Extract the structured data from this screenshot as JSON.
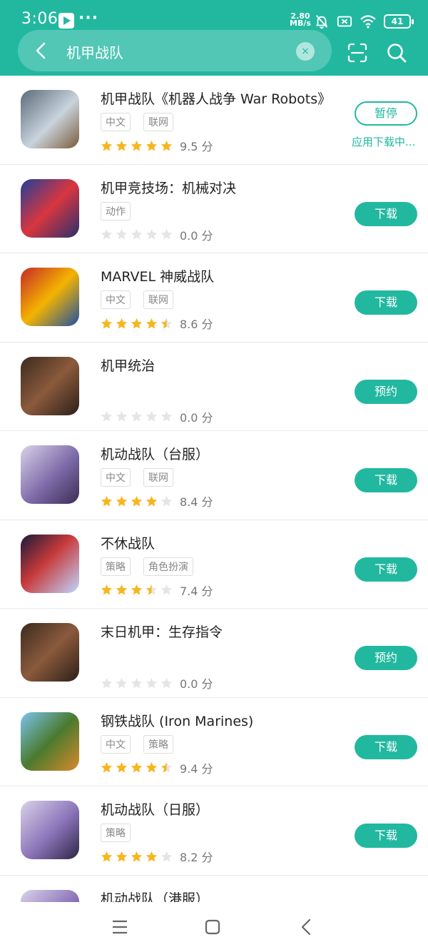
{
  "status_bar": {
    "time": "3:06",
    "more": "···",
    "speed_value": "2.80",
    "speed_unit": "MB/s",
    "battery": "41"
  },
  "search": {
    "query": "机甲战队",
    "clear_symbol": "×"
  },
  "colors": {
    "accent": "#22b8a0",
    "star_filled": "#f7b61f",
    "star_empty": "#e5e5e5"
  },
  "apps": [
    {
      "title": "机甲战队《机器人战争 War Robots》",
      "tags": [
        "中文",
        "联网"
      ],
      "stars": 5,
      "score": "9.5 分",
      "action": "暂停",
      "status": "应用下载中..."
    },
    {
      "title": "机甲竞技场：机械对决",
      "tags": [
        "动作"
      ],
      "stars": 0,
      "score": "0.0 分",
      "action": "下载"
    },
    {
      "title": "MARVEL 神威战队",
      "tags": [
        "中文",
        "联网"
      ],
      "stars": 4.5,
      "score": "8.6 分",
      "action": "下载"
    },
    {
      "title": "机甲统治",
      "tags": [],
      "stars": 0,
      "score": "0.0 分",
      "action": "预约"
    },
    {
      "title": "机动战队（台服）",
      "tags": [
        "中文",
        "联网"
      ],
      "stars": 4,
      "score": "8.4 分",
      "action": "下载"
    },
    {
      "title": "不休战队",
      "tags": [
        "策略",
        "角色扮演"
      ],
      "stars": 3.5,
      "score": "7.4 分",
      "action": "下载"
    },
    {
      "title": "末日机甲：生存指令",
      "tags": [],
      "stars": 0,
      "score": "0.0 分",
      "action": "预约"
    },
    {
      "title": "钢铁战队 (Iron Marines)",
      "tags": [
        "中文",
        "策略"
      ],
      "stars": 4.5,
      "score": "9.4 分",
      "action": "下载"
    },
    {
      "title": "机动战队（日服）",
      "tags": [
        "策略"
      ],
      "stars": 4,
      "score": "8.2 分",
      "action": "下载"
    },
    {
      "title": "机动战队（港服）",
      "tags": [],
      "stars": 0,
      "score": "",
      "action": ""
    }
  ]
}
